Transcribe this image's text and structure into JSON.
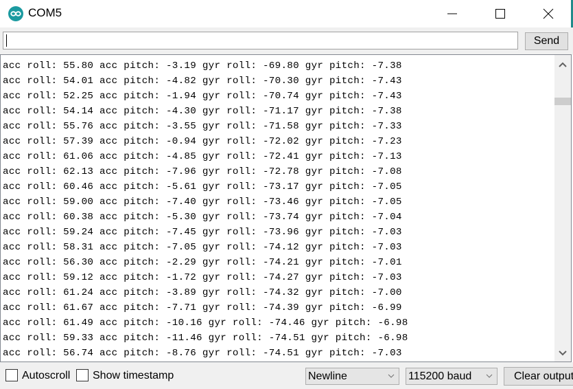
{
  "window": {
    "title": "COM5",
    "logo_icon": "arduino-infinity-icon",
    "controls": [
      "minimize-icon",
      "maximize-icon",
      "close-icon"
    ],
    "colors": {
      "logo": "#1b9aa0",
      "accent_edge": "#1f8a8a"
    }
  },
  "input_bar": {
    "value": "",
    "send_label": "Send"
  },
  "serial_output": {
    "lines": [
      "acc roll: 55.80 acc pitch: -3.19 gyr roll: -69.80 gyr pitch: -7.38",
      "acc roll: 54.01 acc pitch: -4.82 gyr roll: -70.30 gyr pitch: -7.43",
      "acc roll: 52.25 acc pitch: -1.94 gyr roll: -70.74 gyr pitch: -7.43",
      "acc roll: 54.14 acc pitch: -4.30 gyr roll: -71.17 gyr pitch: -7.38",
      "acc roll: 55.76 acc pitch: -3.55 gyr roll: -71.58 gyr pitch: -7.33",
      "acc roll: 57.39 acc pitch: -0.94 gyr roll: -72.02 gyr pitch: -7.23",
      "acc roll: 61.06 acc pitch: -4.85 gyr roll: -72.41 gyr pitch: -7.13",
      "acc roll: 62.13 acc pitch: -7.96 gyr roll: -72.78 gyr pitch: -7.08",
      "acc roll: 60.46 acc pitch: -5.61 gyr roll: -73.17 gyr pitch: -7.05",
      "acc roll: 59.00 acc pitch: -7.40 gyr roll: -73.46 gyr pitch: -7.05",
      "acc roll: 60.38 acc pitch: -5.30 gyr roll: -73.74 gyr pitch: -7.04",
      "acc roll: 59.24 acc pitch: -7.45 gyr roll: -73.96 gyr pitch: -7.03",
      "acc roll: 58.31 acc pitch: -7.05 gyr roll: -74.12 gyr pitch: -7.03",
      "acc roll: 56.30 acc pitch: -2.29 gyr roll: -74.21 gyr pitch: -7.01",
      "acc roll: 59.12 acc pitch: -1.72 gyr roll: -74.27 gyr pitch: -7.03",
      "acc roll: 61.24 acc pitch: -3.89 gyr roll: -74.32 gyr pitch: -7.00",
      "acc roll: 61.67 acc pitch: -7.71 gyr roll: -74.39 gyr pitch: -6.99",
      "acc roll: 61.49 acc pitch: -10.16 gyr roll: -74.46 gyr pitch: -6.98",
      "acc roll: 59.33 acc pitch: -11.46 gyr roll: -74.51 gyr pitch: -6.98",
      "acc roll: 56.74 acc pitch: -8.76 gyr roll: -74.51 gyr pitch: -7.03"
    ],
    "scroll_position_fraction": 0.1
  },
  "footer": {
    "autoscroll": {
      "label": "Autoscroll",
      "checked": false
    },
    "timestamp": {
      "label": "Show timestamp",
      "checked": false
    },
    "line_ending": {
      "selected": "Newline"
    },
    "baud_rate": {
      "selected": "115200 baud"
    },
    "clear_label": "Clear output"
  }
}
